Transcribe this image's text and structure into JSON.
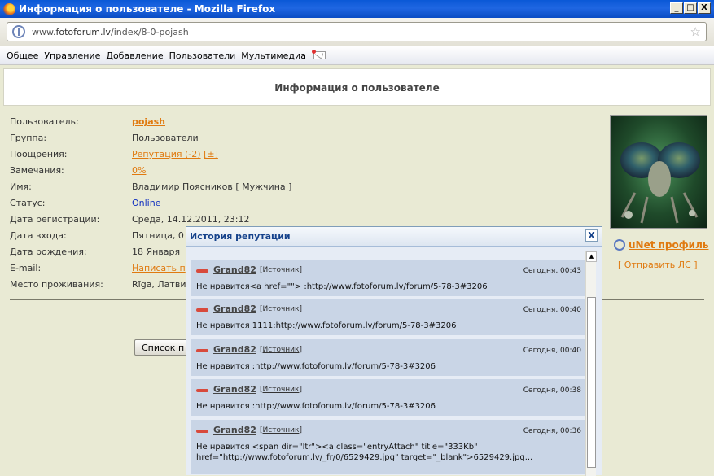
{
  "window": {
    "title": "Информация о пользователе - Mozilla Firefox",
    "controls": [
      "_",
      "□",
      "X"
    ]
  },
  "address": {
    "url_prefix": "www.",
    "url_host": "fotoforum.lv",
    "url_path": "/index/8-0-pojash"
  },
  "menu": {
    "items": [
      "Общее",
      "Управление",
      "Добавление",
      "Пользователи",
      "Мультимедиа"
    ]
  },
  "page": {
    "heading": "Информация о пользователе"
  },
  "profile": {
    "rows": [
      {
        "label": "Пользователь:",
        "value": "pojash"
      },
      {
        "label": "Группа:",
        "value": "Пользователи"
      },
      {
        "label": "Поощрения:",
        "value": "Репутация (-2)",
        "extra": "[±]"
      },
      {
        "label": "Замечания:",
        "value": "0%"
      },
      {
        "label": "Имя:",
        "value": "Владимир Поясников [ Мужчина ]"
      },
      {
        "label": "Статус:",
        "value": "Online"
      },
      {
        "label": "Дата регистрации:",
        "value": "Среда, 14.12.2011, 23:12"
      },
      {
        "label": "Дата входа:",
        "value": "Пятница, 0"
      },
      {
        "label": "Дата рождения:",
        "value": "18 Января"
      },
      {
        "label": "E-mail:",
        "value": "Написать п"
      },
      {
        "label": "Место проживания:",
        "value": "Rīga, Латви"
      }
    ],
    "list_button": "Список п",
    "unet_profile": "uNet профиль",
    "send_pm": "[ Отправить ЛС ]"
  },
  "reputation_popup": {
    "title": "История репутации",
    "close": "X",
    "entries": [
      {
        "user": "Grand82",
        "source": "Источник",
        "date": "Сегодня, 00:43",
        "message": "Не нравится<a href=\"\"> :http://www.fotoforum.lv/forum/5-78-3#3206"
      },
      {
        "user": "Grand82",
        "source": "Источник",
        "date": "Сегодня, 00:40",
        "message": "Не нравится 1111:http://www.fotoforum.lv/forum/5-78-3#3206"
      },
      {
        "user": "Grand82",
        "source": "Источник",
        "date": "Сегодня, 00:40",
        "message": "Не нравится :http://www.fotoforum.lv/forum/5-78-3#3206"
      },
      {
        "user": "Grand82",
        "source": "Источник",
        "date": "Сегодня, 00:38",
        "message": "Не нравится :http://www.fotoforum.lv/forum/5-78-3#3206"
      },
      {
        "user": "Grand82",
        "source": "Источник",
        "date": "Сегодня, 00:36",
        "message": "Не нравится <span dir=\"ltr\"><a class=\"entryAttach\" title=\"333Kb\" href=\"http://www.fotoforum.lv/_fr/0/6529429.jpg\" target=\"_blank\">6529429.jpg..."
      }
    ]
  }
}
